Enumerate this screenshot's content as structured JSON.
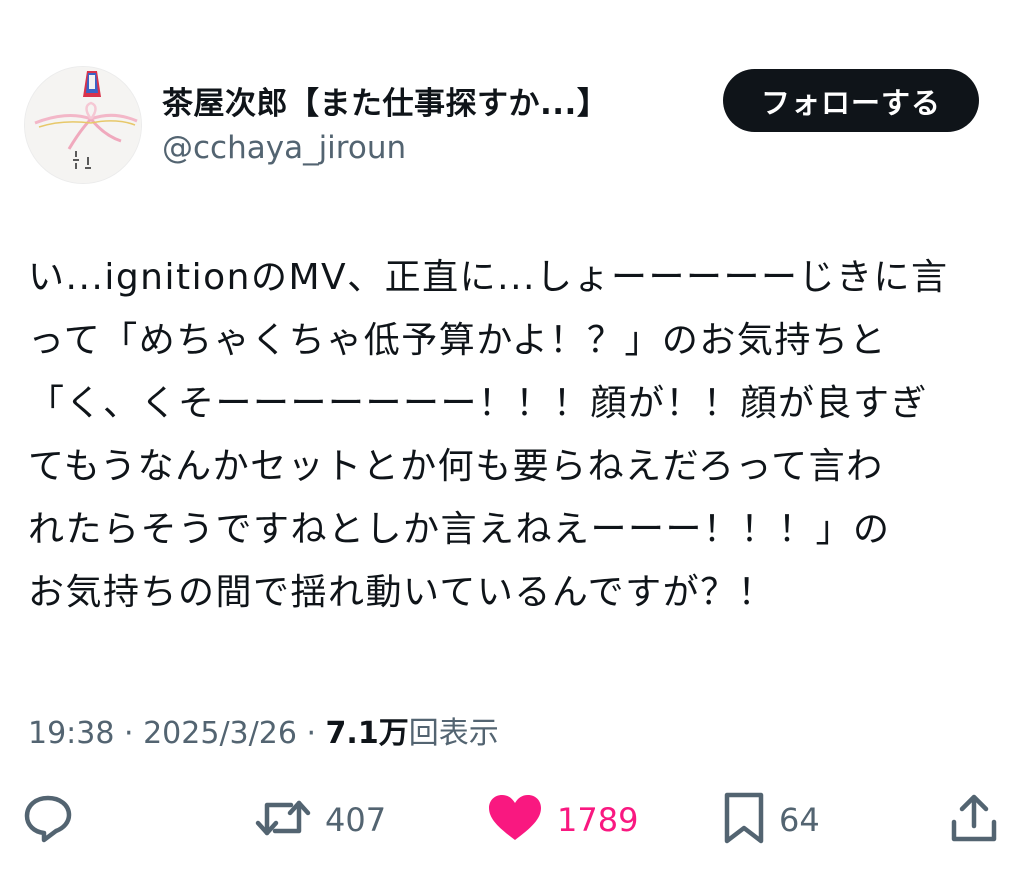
{
  "user": {
    "display_name": "茶屋次郎【また仕事探すか...】",
    "handle": "@cchaya_jiroun"
  },
  "follow_button": {
    "label": "フォローする"
  },
  "tweet": {
    "text": "い...ignitionのMV、正直に...しょーーーーーじきに言\nって「めちゃくちゃ低予算かよ！？」のお気持ちと\n「く、くそーーーーーーー！！！顔が！！顔が良すぎ\nてもうなんかセットとか何も要らねえだろって言わ\nれたらそうですねとしか言えねえーーー！！！」の\nお気持ちの間で揺れ動いているんですが？！"
  },
  "meta": {
    "time": "19:38",
    "separator": "·",
    "date": "2025/3/26",
    "views_count": "7.1万",
    "views_label": "回表示"
  },
  "actions": {
    "reply": {
      "icon": "reply-icon"
    },
    "retweet": {
      "icon": "retweet-icon",
      "count": "407"
    },
    "like": {
      "icon": "heart-icon",
      "count": "1789",
      "color": "#f91880"
    },
    "bookmark": {
      "icon": "bookmark-icon",
      "count": "64"
    },
    "share": {
      "icon": "share-icon"
    }
  },
  "colors": {
    "text_primary": "#0f1419",
    "text_secondary": "#536471",
    "like_pink": "#f91880",
    "button_dark": "#0f1419"
  }
}
